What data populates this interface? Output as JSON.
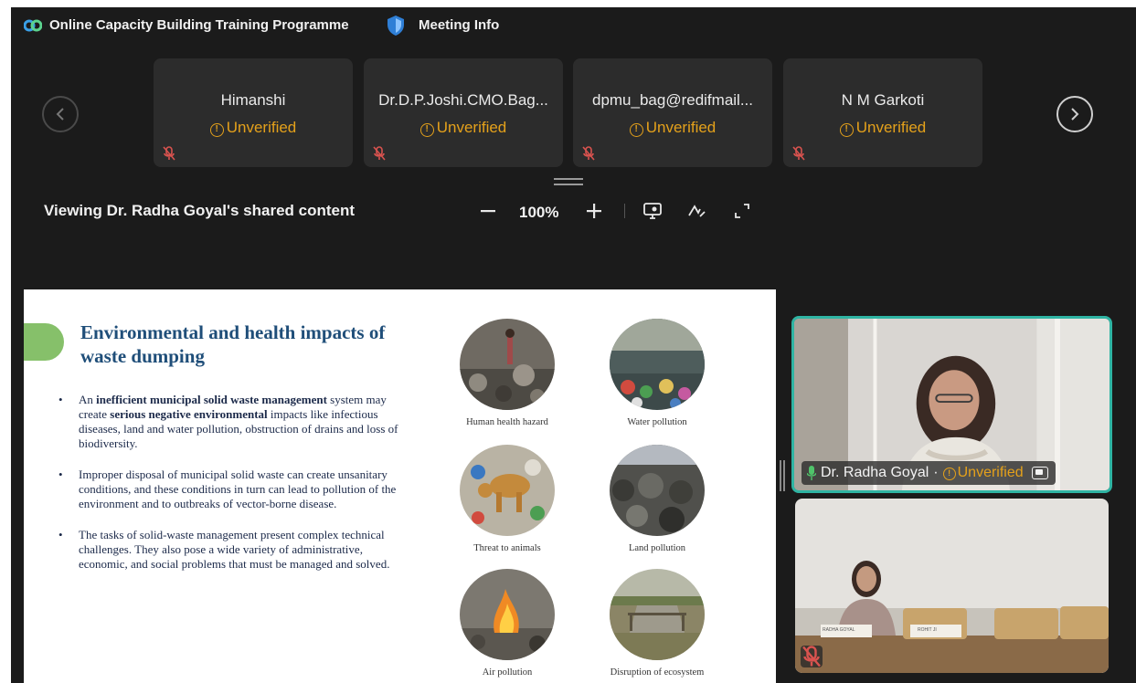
{
  "window": {
    "title": "Online Capacity Building Training Programme",
    "meeting_info_label": "Meeting Info"
  },
  "participants": [
    {
      "name": "Himanshi",
      "status": "Unverified",
      "muted": true
    },
    {
      "name": "Dr.D.P.Joshi.CMO.Bag...",
      "status": "Unverified",
      "muted": true
    },
    {
      "name": "dpmu_bag@redifmail...",
      "status": "Unverified",
      "muted": true
    },
    {
      "name": "N M Garkoti",
      "status": "Unverified",
      "muted": true
    }
  ],
  "content_toolbar": {
    "viewing_label": "Viewing Dr. Radha Goyal's shared content",
    "zoom_level": "100%",
    "zoom_out_icon": "minus-icon",
    "zoom_in_icon": "plus-icon",
    "icons": [
      "screen-icon",
      "annotate-icon",
      "fullscreen-icon"
    ]
  },
  "slide": {
    "title": "Environmental and health impacts of waste dumping",
    "bullets": [
      {
        "parts": [
          {
            "text": "An ",
            "bold": false
          },
          {
            "text": "inefficient municipal solid waste management",
            "bold": true
          },
          {
            "text": " system may create ",
            "bold": false
          },
          {
            "text": "serious negative environmental",
            "bold": true
          },
          {
            "text": " impacts like infectious diseases, land and water pollution, obstruction of drains and loss of biodiversity.",
            "bold": false
          }
        ]
      },
      {
        "parts": [
          {
            "text": "Improper disposal of municipal solid waste can create unsanitary conditions, and these conditions in turn can lead to pollution of the environment and to outbreaks of vector-borne disease.",
            "bold": false
          }
        ]
      },
      {
        "parts": [
          {
            "text": "The tasks of solid-waste management present complex technical challenges. They also pose a wide variety of administrative, economic, and social problems that must be managed and solved.",
            "bold": false
          }
        ]
      }
    ],
    "images": [
      {
        "caption": "Human health hazard"
      },
      {
        "caption": "Water pollution"
      },
      {
        "caption": "Threat to animals"
      },
      {
        "caption": "Land pollution"
      },
      {
        "caption": "Air pollution"
      },
      {
        "caption": "Disruption of ecosystem"
      }
    ]
  },
  "videos": {
    "active_speaker": {
      "name": "Dr. Radha Goyal",
      "separator": "·",
      "status": "Unverified",
      "accent": "#2fb4a3"
    },
    "room_camera": {
      "name_plates": [
        "RADHA GOYAL",
        "ROHIT JI"
      ],
      "muted": true
    }
  },
  "colors": {
    "background": "#1b1b1b",
    "card": "#2c2c2c",
    "status_warning": "#e4a11b",
    "mute_red": "#d9534f",
    "slide_title": "#1f4e79",
    "slide_pill": "#86c06a"
  }
}
